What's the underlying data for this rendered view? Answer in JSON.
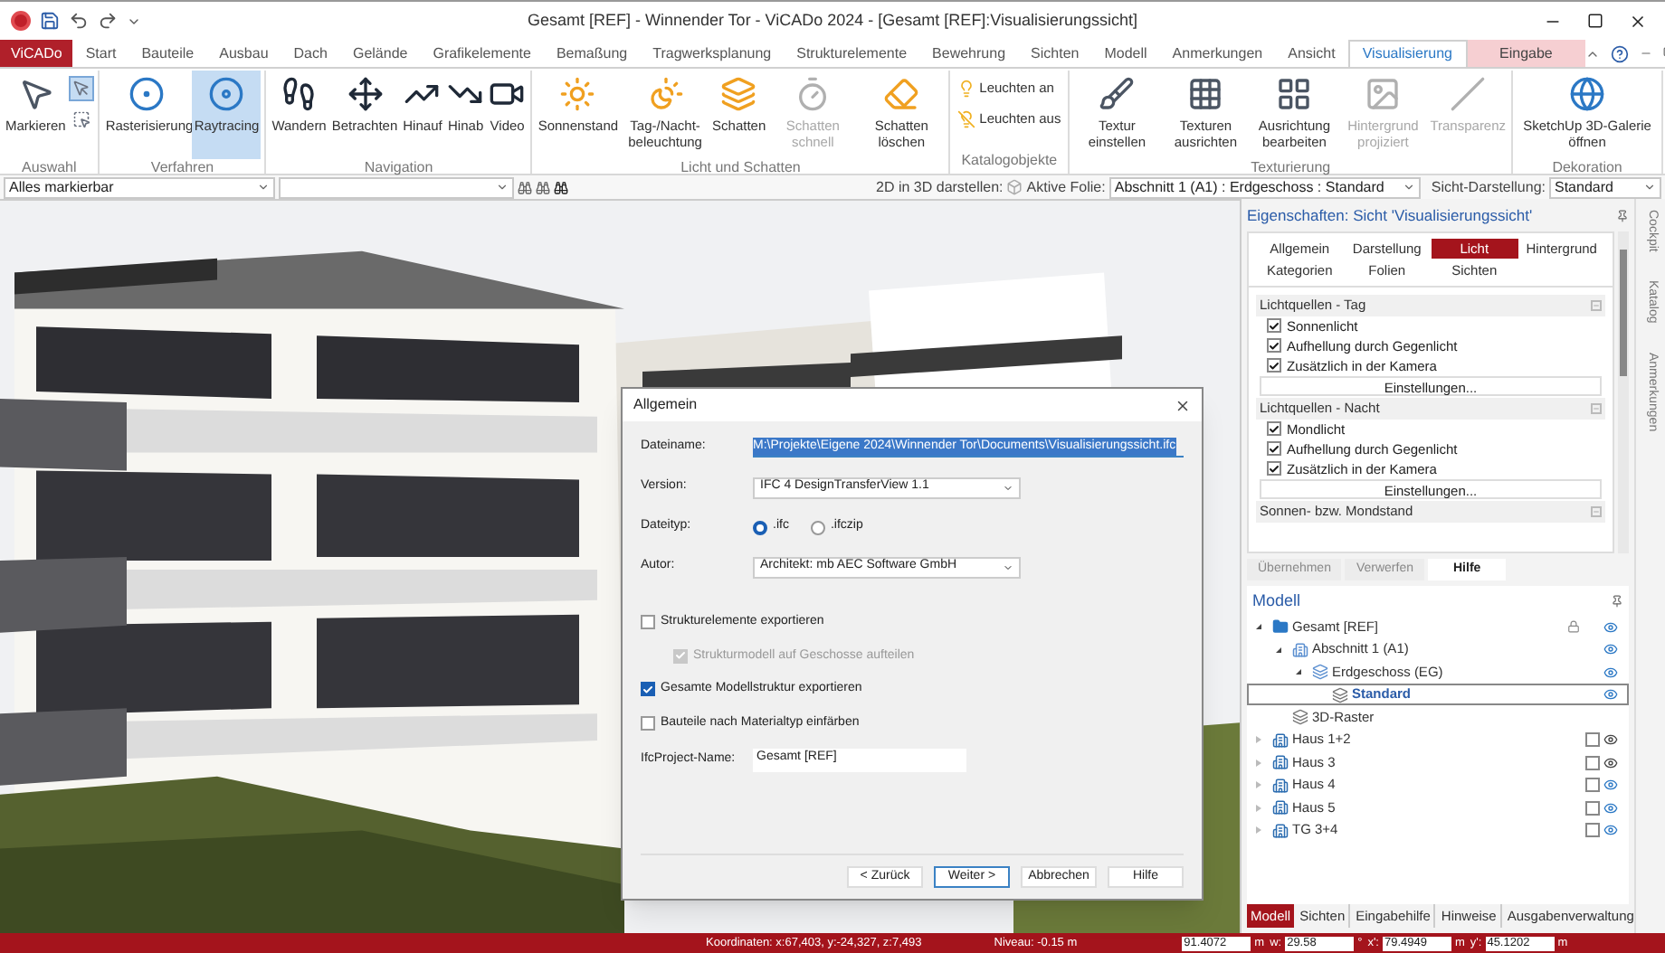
{
  "title_bar": {
    "title": "Gesamt [REF] - Winnender Tor - ViCADo 2024 - [Gesamt [REF]:Visualisierungssicht]"
  },
  "menu_tabs": [
    {
      "label": "ViCADo",
      "kind": "app",
      "selected": false
    },
    {
      "label": "Start",
      "kind": "tab",
      "selected": false
    },
    {
      "label": "Bauteile",
      "kind": "tab",
      "selected": false
    },
    {
      "label": "Ausbau",
      "kind": "tab",
      "selected": false
    },
    {
      "label": "Dach",
      "kind": "tab",
      "selected": false
    },
    {
      "label": "Gelände",
      "kind": "tab",
      "selected": false
    },
    {
      "label": "Grafikelemente",
      "kind": "tab",
      "selected": false
    },
    {
      "label": "Bemaßung",
      "kind": "tab",
      "selected": false
    },
    {
      "label": "Tragwerksplanung",
      "kind": "tab",
      "selected": false
    },
    {
      "label": "Strukturelemente",
      "kind": "tab",
      "selected": false
    },
    {
      "label": "Bewehrung",
      "kind": "tab",
      "selected": false
    },
    {
      "label": "Sichten",
      "kind": "tab",
      "selected": false
    },
    {
      "label": "Modell",
      "kind": "tab",
      "selected": false
    },
    {
      "label": "Anmerkungen",
      "kind": "tab",
      "selected": false
    },
    {
      "label": "Ansicht",
      "kind": "tab",
      "selected": false
    },
    {
      "label": "Visualisierung",
      "kind": "tab",
      "selected": true
    },
    {
      "label": "Eingabe",
      "kind": "context",
      "selected": false
    }
  ],
  "ribbon_groups": [
    {
      "label": "Auswahl",
      "buttons": [
        {
          "label": "Markieren",
          "kind": "large",
          "selected": false,
          "disabled": false
        },
        {
          "kind": "icon",
          "selected": true,
          "disabled": false
        },
        {
          "kind": "icon",
          "selected": false,
          "disabled": false
        }
      ]
    },
    {
      "label": "Verfahren",
      "buttons": [
        {
          "label": "Rasterisierung",
          "kind": "large",
          "selected": false,
          "disabled": false
        },
        {
          "label": "Raytracing",
          "kind": "large",
          "selected": true,
          "disabled": false
        }
      ]
    },
    {
      "label": "Navigation",
      "buttons": [
        {
          "label": "Wandern",
          "kind": "large",
          "selected": false,
          "disabled": false
        },
        {
          "label": "Betrachten",
          "kind": "large",
          "selected": false,
          "disabled": false
        },
        {
          "label": "Hinauf",
          "kind": "large",
          "selected": false,
          "disabled": false
        },
        {
          "label": "Hinab",
          "kind": "large",
          "selected": false,
          "disabled": false
        },
        {
          "label": "Video",
          "kind": "large",
          "selected": false,
          "disabled": false
        }
      ]
    },
    {
      "label": "Licht und Schatten",
      "buttons": [
        {
          "label": "Sonnenstand",
          "kind": "large",
          "selected": false,
          "disabled": false
        },
        {
          "label": "Tag-/Nacht-beleuchtung",
          "kind": "large",
          "selected": false,
          "disabled": false
        },
        {
          "label": "Schatten",
          "kind": "large",
          "selected": false,
          "disabled": false
        },
        {
          "label": "Schatten schnell",
          "kind": "large",
          "selected": false,
          "disabled": true
        },
        {
          "label": "Schatten löschen",
          "kind": "large",
          "selected": false,
          "disabled": false
        }
      ]
    },
    {
      "label": "Katalogobjekte",
      "buttons": [
        {
          "label": "Leuchten an",
          "kind": "small",
          "selected": false,
          "disabled": false
        },
        {
          "label": "Leuchten aus",
          "kind": "small",
          "selected": false,
          "disabled": false
        }
      ]
    },
    {
      "label": "Texturierung",
      "buttons": [
        {
          "label": "Textur einstellen",
          "kind": "large",
          "selected": false,
          "disabled": false
        },
        {
          "label": "Texturen ausrichten",
          "kind": "large",
          "selected": false,
          "disabled": false
        },
        {
          "label": "Ausrichtung bearbeiten",
          "kind": "large",
          "selected": false,
          "disabled": false
        },
        {
          "label": "Hintergrund projiziert",
          "kind": "large",
          "selected": false,
          "disabled": true
        },
        {
          "label": "Transparenz",
          "kind": "large",
          "selected": false,
          "disabled": true
        }
      ]
    },
    {
      "label": "Dekoration",
      "buttons": [
        {
          "label": "SketchUp 3D-Galerie öffnen",
          "kind": "wide",
          "selected": false,
          "disabled": false
        }
      ]
    }
  ],
  "toolbar": {
    "selection_filter": "Alles markierbar",
    "label_2d3d": "2D in 3D darstellen:",
    "active_layer_label": "Aktive Folie:",
    "active_layer": "Abschnitt 1 (A1) : Erdgeschoss : Standard",
    "view_display_label": "Sicht-Darstellung:",
    "view_display": "Standard"
  },
  "dialog": {
    "title": "Allgemein",
    "filename": {
      "label": "Dateiname:",
      "value": "M:\\Projekte\\Eigene 2024\\Winnender Tor\\Documents\\Visualisierungssicht.ifc",
      "highlighted": true
    },
    "version": {
      "label": "Version:",
      "value": "IFC 4 DesignTransferView 1.1"
    },
    "filetype": {
      "label": "Dateityp:",
      "options": [
        {
          "label": ".ifc",
          "selected": true
        },
        {
          "label": ".ifczip",
          "selected": false
        }
      ]
    },
    "author": {
      "label": "Autor:",
      "value": "Architekt: mb AEC Software GmbH"
    },
    "options": [
      {
        "label": "Strukturelemente exportieren",
        "checked": false,
        "disabled": false,
        "children": [
          {
            "label": "Strukturmodell auf Geschosse aufteilen",
            "checked": true,
            "disabled": true
          }
        ]
      },
      {
        "label": "Gesamte Modellstruktur exportieren",
        "checked": true,
        "disabled": false
      },
      {
        "label": "Bauteile nach Materialtyp einfärben",
        "checked": false,
        "disabled": false
      }
    ],
    "project_name": {
      "label": "IfcProject-Name:",
      "value": "Gesamt [REF]"
    },
    "buttons": [
      {
        "label": "< Zurück",
        "default": false
      },
      {
        "label": "Weiter >",
        "default": true
      },
      {
        "label": "Abbrechen",
        "default": false
      },
      {
        "label": "Hilfe",
        "default": false
      }
    ]
  },
  "properties": {
    "title": "Eigenschaften: Sicht 'Visualisierungssicht'",
    "tabs": [
      {
        "label": "Allgemein",
        "selected": false
      },
      {
        "label": "Darstellung",
        "selected": false
      },
      {
        "label": "Licht",
        "selected": true
      },
      {
        "label": "Hintergrund",
        "selected": false
      },
      {
        "label": "Kategorien",
        "selected": false
      },
      {
        "label": "Folien",
        "selected": false
      },
      {
        "label": "Sichten",
        "selected": false
      }
    ],
    "sections": [
      {
        "title": "Lichtquellen - Tag",
        "options": [
          {
            "label": "Sonnenlicht",
            "checked": true
          },
          {
            "label": "Aufhellung durch Gegenlicht",
            "checked": true
          },
          {
            "label": "Zusätzlich in der Kamera",
            "checked": true
          }
        ],
        "button": "Einstellungen..."
      },
      {
        "title": "Lichtquellen - Nacht",
        "options": [
          {
            "label": "Mondlicht",
            "checked": true
          },
          {
            "label": "Aufhellung durch Gegenlicht",
            "checked": true
          },
          {
            "label": "Zusätzlich in der Kamera",
            "checked": true
          }
        ],
        "button": "Einstellungen..."
      },
      {
        "title": "Sonnen- bzw. Mondstand"
      }
    ],
    "buttons": [
      {
        "label": "Übernehmen",
        "disabled": true
      },
      {
        "label": "Verwerfen",
        "disabled": true
      },
      {
        "label": "Hilfe",
        "disabled": false
      }
    ]
  },
  "model_tree": {
    "title": "Modell",
    "items": [
      {
        "label": "Gesamt [REF]",
        "kind": "project",
        "expanded": true,
        "selected": false,
        "locked": true,
        "visible": true,
        "children": [
          {
            "label": "Abschnitt 1 (A1)",
            "kind": "section",
            "expanded": true,
            "selected": false,
            "visible": true,
            "children": [
              {
                "label": "Erdgeschoss (EG)",
                "kind": "floor",
                "expanded": true,
                "selected": false,
                "visible": true,
                "children": [
                  {
                    "label": "Standard",
                    "kind": "layer",
                    "selected": true,
                    "visible": true
                  }
                ]
              }
            ]
          },
          {
            "label": "3D-Raster",
            "kind": "layer",
            "selected": false
          }
        ]
      },
      {
        "label": "Haus 1+2",
        "kind": "building",
        "expanded": false,
        "selected": false,
        "checked": false,
        "visible": false
      },
      {
        "label": "Haus 3",
        "kind": "building",
        "expanded": false,
        "selected": false,
        "checked": false,
        "visible": false
      },
      {
        "label": "Haus 4",
        "kind": "building",
        "expanded": false,
        "selected": false,
        "checked": false,
        "visible": true
      },
      {
        "label": "Haus 5",
        "kind": "building",
        "expanded": false,
        "selected": false,
        "checked": false,
        "visible": true
      },
      {
        "label": "TG 3+4",
        "kind": "building",
        "expanded": false,
        "selected": false,
        "checked": false,
        "visible": true
      }
    ]
  },
  "bottom_tabs": [
    {
      "label": "Modell",
      "selected": true
    },
    {
      "label": "Sichten",
      "selected": false
    },
    {
      "label": "Eingabehilfe",
      "selected": false
    },
    {
      "label": "Hinweise",
      "selected": false
    },
    {
      "label": "Ausgabenverwaltung",
      "selected": false
    }
  ],
  "side_tabs": [
    {
      "label": "Cockpit"
    },
    {
      "label": "Katalog"
    },
    {
      "label": "Anmerkungen"
    }
  ],
  "status_bar": {
    "coordinates": "Koordinaten: x:67,403, y:-24,327, z:7,493",
    "niveau": "Niveau: -0.15 m",
    "fields": [
      {
        "value": "91.4072",
        "unit": "m"
      },
      {
        "label": "w:",
        "value": "29.58",
        "unit": "°"
      },
      {
        "label": "x':",
        "value": "79.4949",
        "unit": "m"
      },
      {
        "label": "y':",
        "value": "45.1202",
        "unit": "m"
      }
    ]
  }
}
